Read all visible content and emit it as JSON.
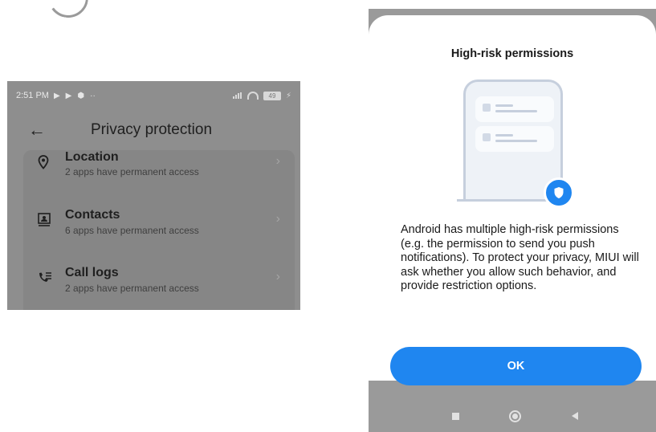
{
  "left_screen": {
    "status_bar": {
      "time": "2:51 PM",
      "icons": [
        "play-icon",
        "play-icon",
        "shield-icon",
        "more-dots"
      ],
      "battery": "49"
    },
    "header": {
      "back_icon": "back-arrow-icon",
      "title": "Privacy protection"
    },
    "items": [
      {
        "icon": "location-icon",
        "title": "Location",
        "subtitle": "2 apps have permanent access"
      },
      {
        "icon": "contacts-icon",
        "title": "Contacts",
        "subtitle": "6 apps have permanent access"
      },
      {
        "icon": "call-logs-icon",
        "title": "Call logs",
        "subtitle": "2 apps have permanent access"
      }
    ]
  },
  "dialog": {
    "title": "High-risk permissions",
    "body": "Android has multiple high-risk permissions (e.g. the permission to send you push notifications). To protect your privacy, MIUI will ask whether you allow such behavior, and provide restriction options.",
    "ok_label": "OK",
    "accent_color": "#1f86f0"
  },
  "nav_bar": {
    "icons": [
      "recents-square-icon",
      "home-circle-icon",
      "back-triangle-icon"
    ]
  }
}
